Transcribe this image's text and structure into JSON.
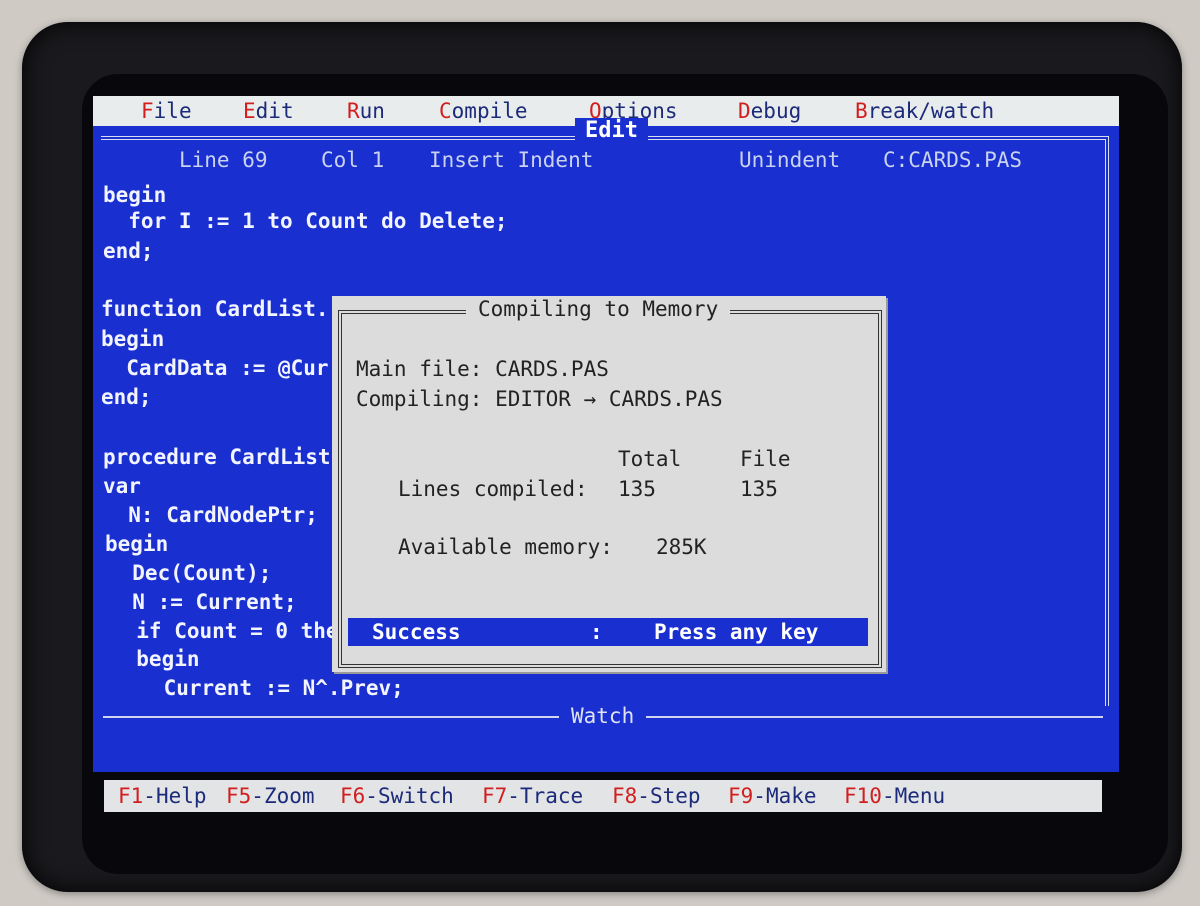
{
  "menu": [
    {
      "hot": "F",
      "rest": "ile"
    },
    {
      "hot": "E",
      "rest": "dit"
    },
    {
      "hot": "R",
      "rest": "un"
    },
    {
      "hot": "C",
      "rest": "ompile"
    },
    {
      "hot": "O",
      "rest": "ptions"
    },
    {
      "hot": "D",
      "rest": "ebug"
    },
    {
      "hot": "B",
      "rest": "reak/watch"
    }
  ],
  "editor": {
    "title": "Edit",
    "status": {
      "line": "Line 69",
      "col": "Col 1",
      "mode": "Insert Indent",
      "unindent": "Unindent",
      "filename": "C:CARDS.PAS"
    },
    "code": [
      "begin",
      "  for I := 1 to Count do Delete;",
      "end;",
      "",
      "function CardList.",
      "begin",
      "  CardData := @Cur",
      "end;",
      "",
      "procedure CardList",
      "var",
      "  N: CardNodePtr;",
      "begin",
      "  Dec(Count);",
      "  N := Current;",
      "  if Count = 0 the",
      "  begin",
      "    Current := N^.Prev;"
    ]
  },
  "watch": {
    "title": "Watch"
  },
  "dialog": {
    "title": "Compiling to Memory",
    "main_file": "Main file: CARDS.PAS",
    "compiling": "Compiling: EDITOR → CARDS.PAS",
    "col_total": "Total",
    "col_file": "File",
    "lines_label": "Lines compiled:",
    "lines_total": "135",
    "lines_file": "135",
    "memory_label": "Available memory:",
    "memory_value": "285K",
    "result": "Success",
    "sep": ":",
    "prompt": "Press any key"
  },
  "function_keys": [
    {
      "key": "F1",
      "label": "-Help"
    },
    {
      "key": "F5",
      "label": "-Zoom"
    },
    {
      "key": "F6",
      "label": "-Switch"
    },
    {
      "key": "F7",
      "label": "-Trace"
    },
    {
      "key": "F8",
      "label": "-Step"
    },
    {
      "key": "F9",
      "label": "-Make"
    },
    {
      "key": "F10",
      "label": "-Menu"
    }
  ],
  "colors": {
    "editor_bg": "#1a2fd0",
    "menu_bg": "#e9ecec",
    "hotkey": "#d21e1e",
    "dialog_bg": "#dcdcdc"
  }
}
